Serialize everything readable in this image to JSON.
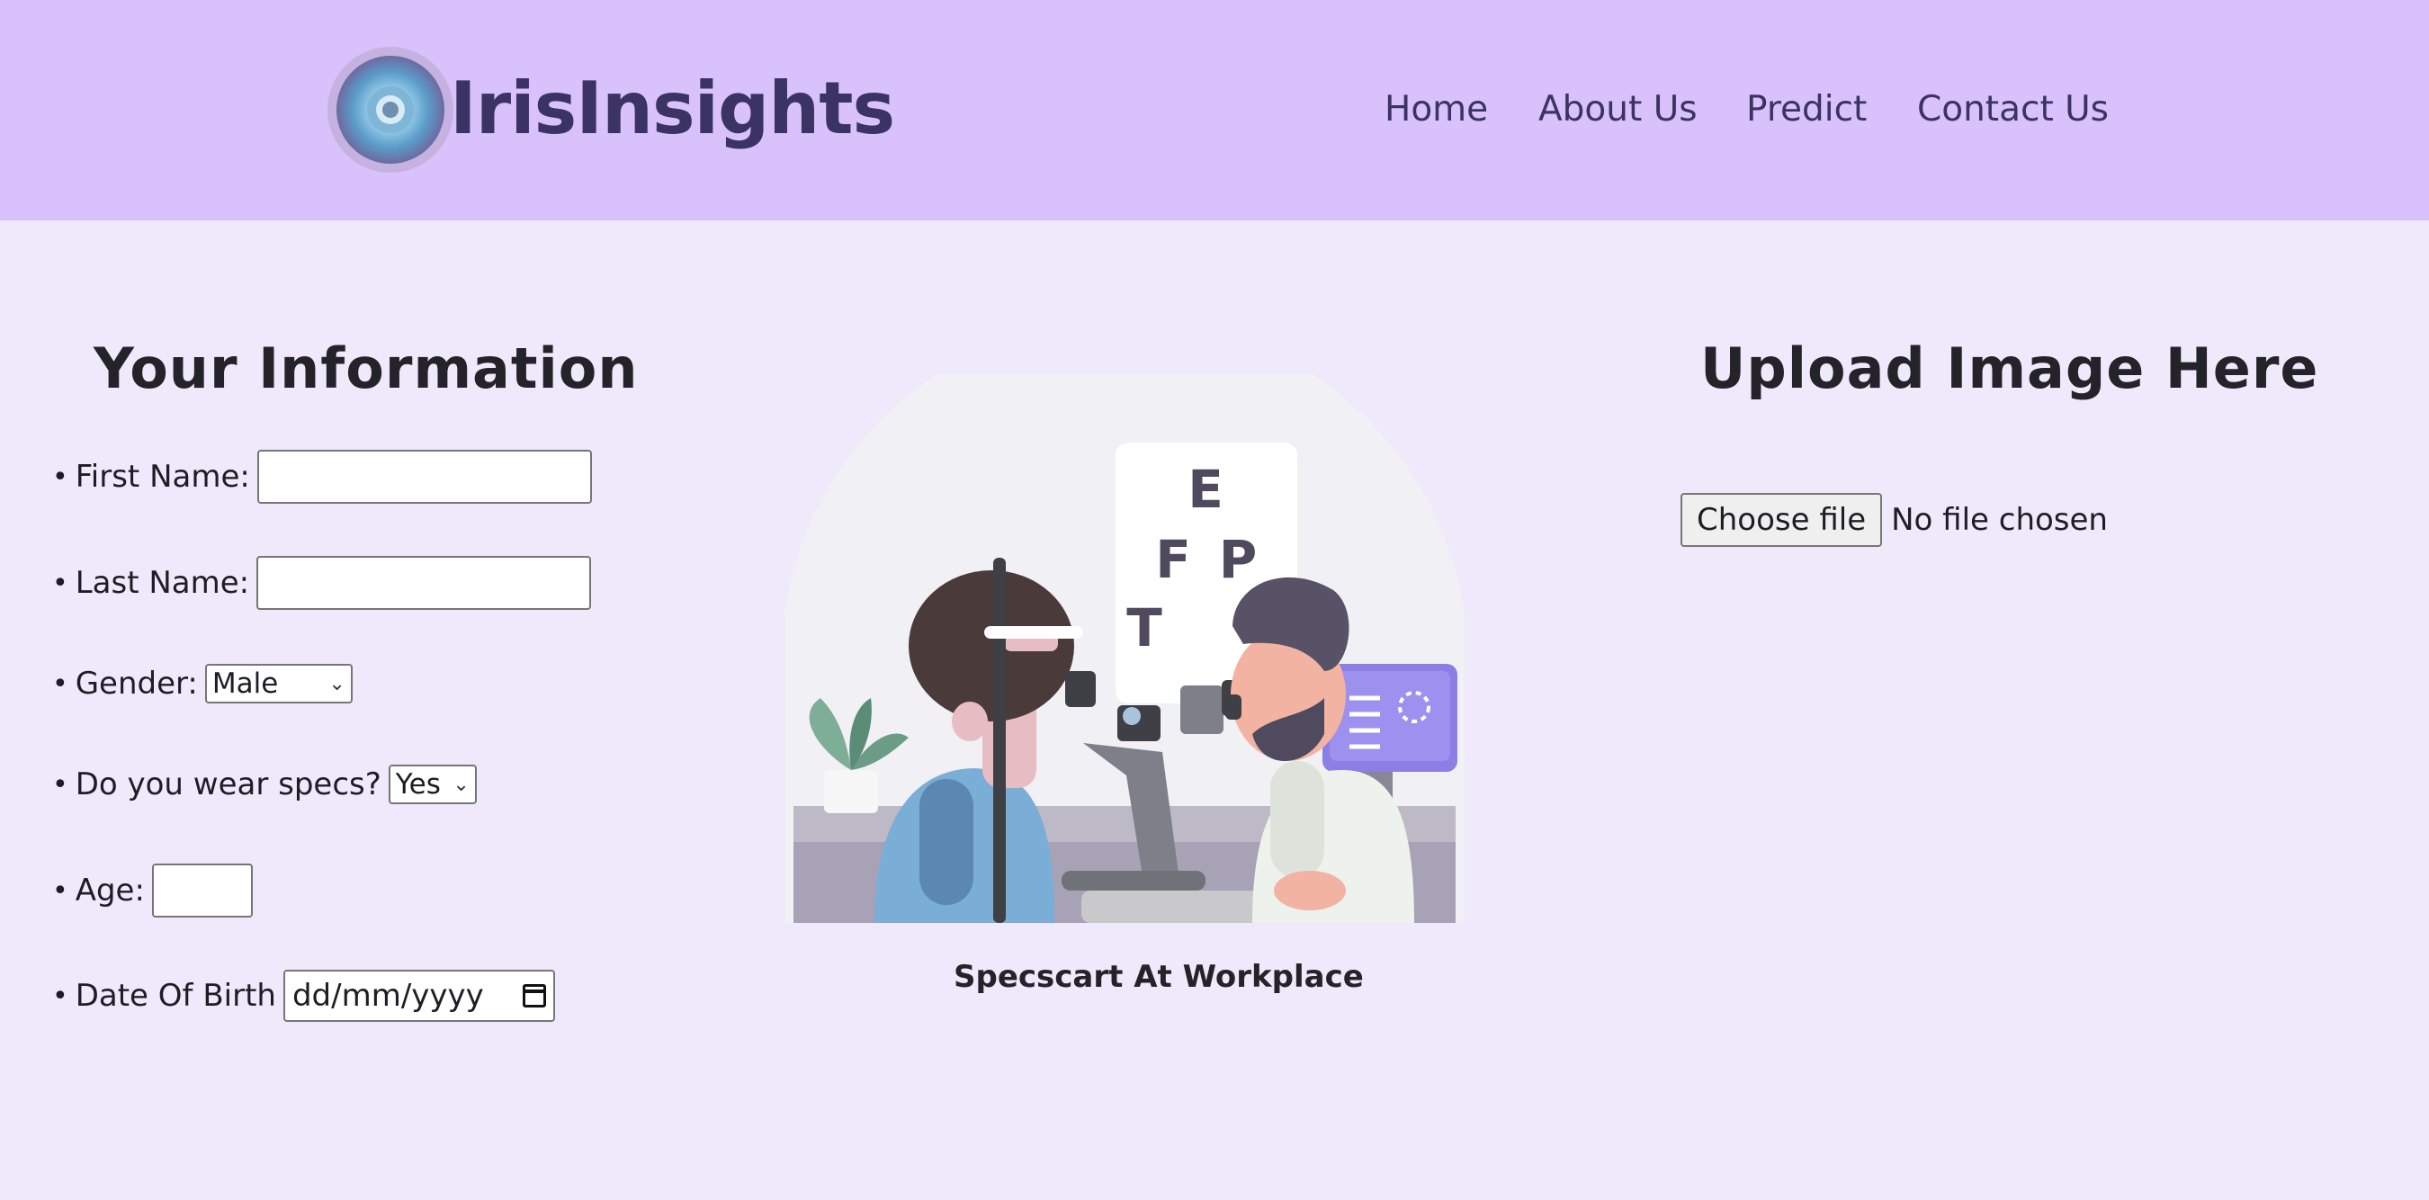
{
  "header": {
    "brand": "IrisInsights",
    "nav": [
      "Home",
      "About Us",
      "Predict",
      "Contact Us"
    ]
  },
  "info": {
    "heading": "Your Information",
    "bullet": "•",
    "first_name_label": "First Name:",
    "first_name_value": "",
    "last_name_label": "Last Name:",
    "last_name_value": "",
    "gender_label": "Gender:",
    "gender_value": "Male",
    "specs_label": "Do you wear specs?",
    "specs_value": "Yes",
    "age_label": "Age:",
    "age_value": "",
    "dob_label": "Date Of Birth",
    "dob_placeholder": "dd/mm/yyyy"
  },
  "illustration": {
    "caption": "Specscart At Workplace",
    "chart_letters": [
      "E",
      "F",
      "P",
      "T"
    ]
  },
  "upload": {
    "heading": "Upload Image Here",
    "button_label": "Choose file",
    "status": "No file chosen"
  },
  "colors": {
    "header_bg": "#d9c2fb",
    "page_bg": "#efe9fb",
    "brand_text": "#3a3363",
    "monitor": "#8b7fe6"
  },
  "icons": [
    "iris-eye-icon",
    "calendar-icon",
    "chevron-down-icon"
  ]
}
